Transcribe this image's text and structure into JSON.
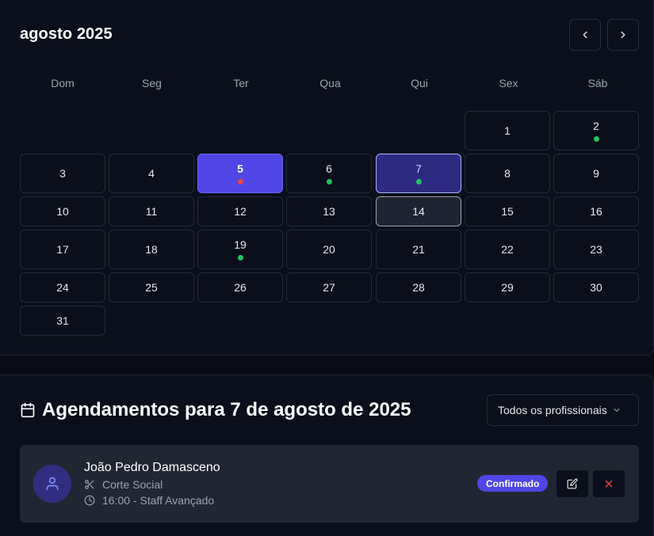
{
  "calendar": {
    "title": "agosto 2025",
    "weekdays": [
      "Dom",
      "Seg",
      "Ter",
      "Qua",
      "Qui",
      "Sex",
      "Sáb"
    ],
    "first_weekday_index": 5,
    "days_in_month": 31,
    "selected_day": 5,
    "active_day": 7,
    "today": 14,
    "dots": {
      "2": "#22c55e",
      "5": "#ef4444",
      "6": "#22c55e",
      "7": "#22c55e",
      "19": "#22c55e"
    },
    "prev_icon": "chevron-left-icon",
    "next_icon": "chevron-right-icon"
  },
  "appointments": {
    "title": "Agendamentos para 7 de agosto de 2025",
    "header_icon": "calendar-icon",
    "filter_label": "Todos os profissionais",
    "items": [
      {
        "client": "João Pedro Damasceno",
        "service": "Corte Social",
        "time": "16:00 - Staff Avançado",
        "status": "Confirmado",
        "avatar_icon": "user-icon"
      }
    ]
  },
  "colors": {
    "accent": "#4f46e5",
    "background": "#080b14",
    "card": "#0b0f1b",
    "dot_green": "#22c55e",
    "dot_red": "#ef4444",
    "delete_red": "#ef4444"
  }
}
